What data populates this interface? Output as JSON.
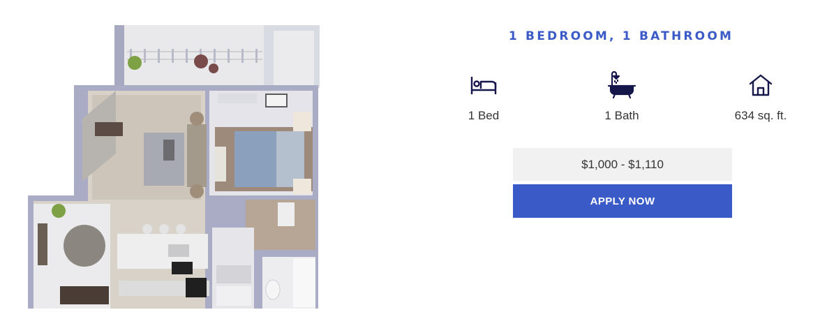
{
  "unit": {
    "title": "1 BEDROOM, 1 BATHROOM",
    "features": {
      "bed": {
        "label": "1 Bed",
        "icon": "bed-icon"
      },
      "bath": {
        "label": "1 Bath",
        "icon": "bathtub-shower-icon"
      },
      "area": {
        "label": "634 sq. ft.",
        "icon": "house-icon"
      }
    },
    "price": "$1,000 - $1,110",
    "apply_label": "APPLY NOW"
  },
  "colors": {
    "accent": "#3a5bc7",
    "icon": "#15164a",
    "text": "#333333",
    "price_bg": "#f1f1f1"
  }
}
